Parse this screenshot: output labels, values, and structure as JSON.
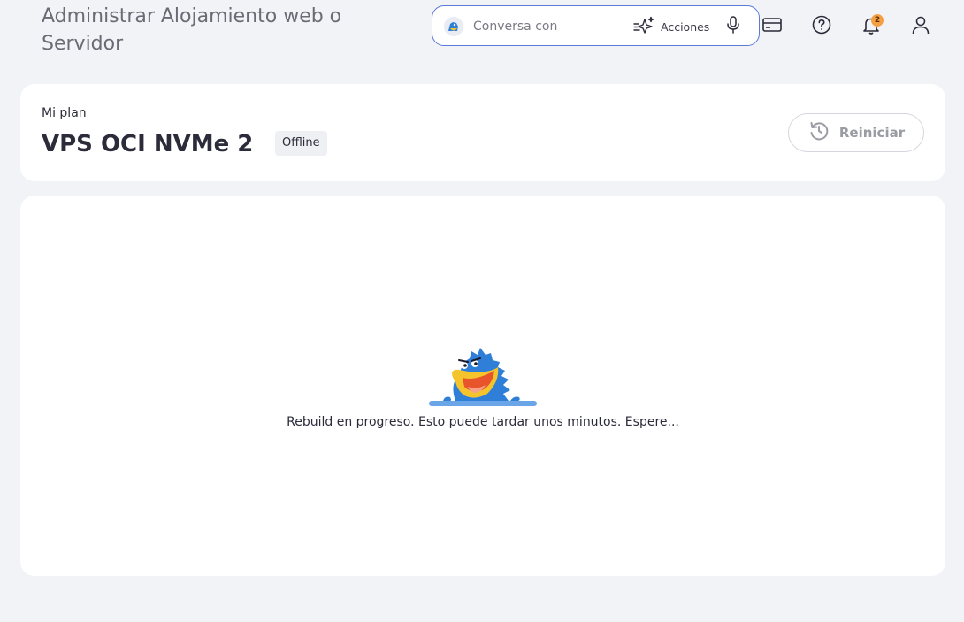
{
  "header": {
    "title": "Administrar Alojamiento web o Servidor",
    "search": {
      "placeholder": "Conversa con",
      "value": ""
    },
    "actions_label": "Acciones",
    "notifications_count": "2",
    "icons": [
      "assistant-avatar-icon",
      "sparkle-actions-icon",
      "microphone-icon",
      "credit-card-icon",
      "help-icon",
      "bell-icon",
      "user-icon"
    ]
  },
  "plan": {
    "label": "Mi plan",
    "name": "VPS OCI NVMe 2",
    "status": "Offline",
    "restart_label": "Reiniciar"
  },
  "content": {
    "message": "Rebuild en progreso. Esto puede tardar unos minutos. Espere..."
  },
  "colors": {
    "background": "#f2f3f7",
    "card": "#ffffff",
    "search_border": "#5b7ad8",
    "badge": "#f4a042",
    "mascot_blue": "#2f7fd9",
    "mascot_yellow": "#f5c42c"
  }
}
